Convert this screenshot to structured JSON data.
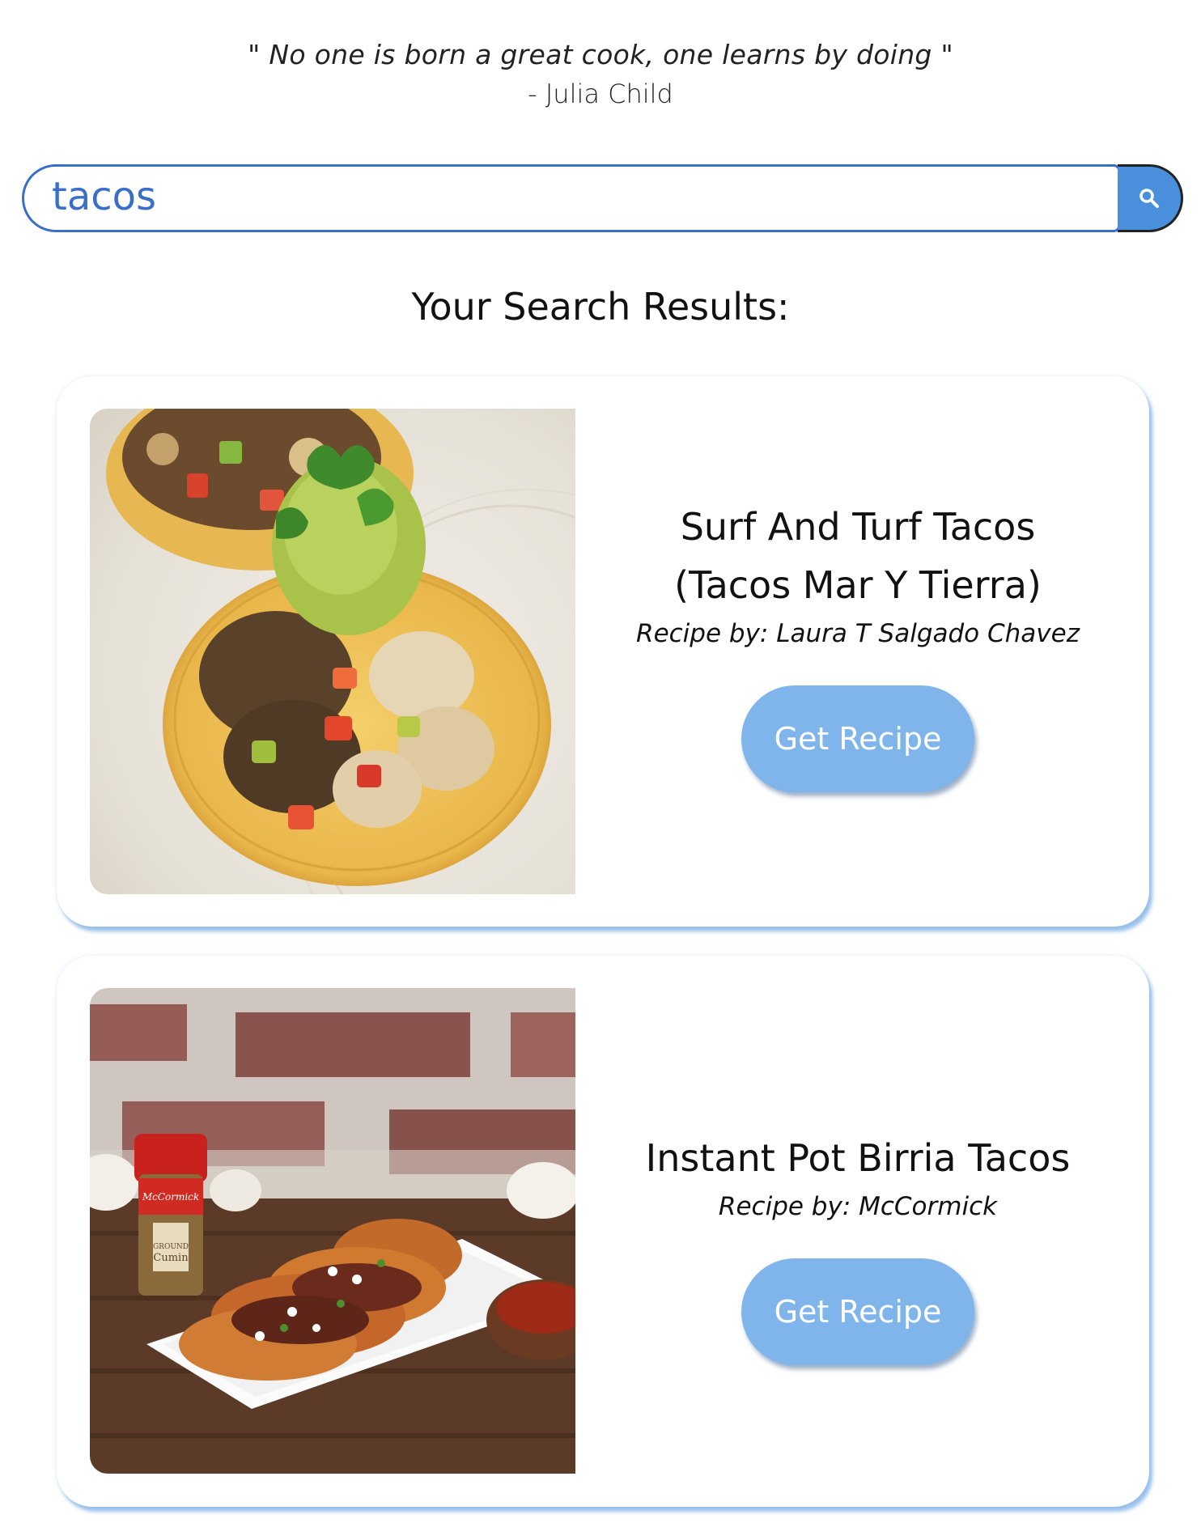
{
  "quote": {
    "text": "\" No one is born a great cook, one learns by doing \"",
    "author": "- Julia Child"
  },
  "search": {
    "value": "tacos",
    "button_icon": "search-icon"
  },
  "results": {
    "title": "Your Search Results:",
    "cards": [
      {
        "title_line1": "Surf And Turf Tacos",
        "title_line2": "(Tacos Mar Y Tierra)",
        "author": "Recipe by: Laura T Salgado Chavez",
        "button_label": "Get Recipe",
        "image": "surf-and-turf-tacos-photo"
      },
      {
        "title_line1": "Instant Pot Birria Tacos",
        "author": "Recipe by: McCormick",
        "button_label": "Get Recipe",
        "image": "birria-tacos-photo",
        "image_label": {
          "brand": "McCormick",
          "product": "GROUND",
          "product_name": "Cumin"
        }
      }
    ]
  },
  "colors": {
    "accent": "#3a6fc9",
    "button": "#7fb5ea",
    "search_button": "#4a8fdc"
  }
}
